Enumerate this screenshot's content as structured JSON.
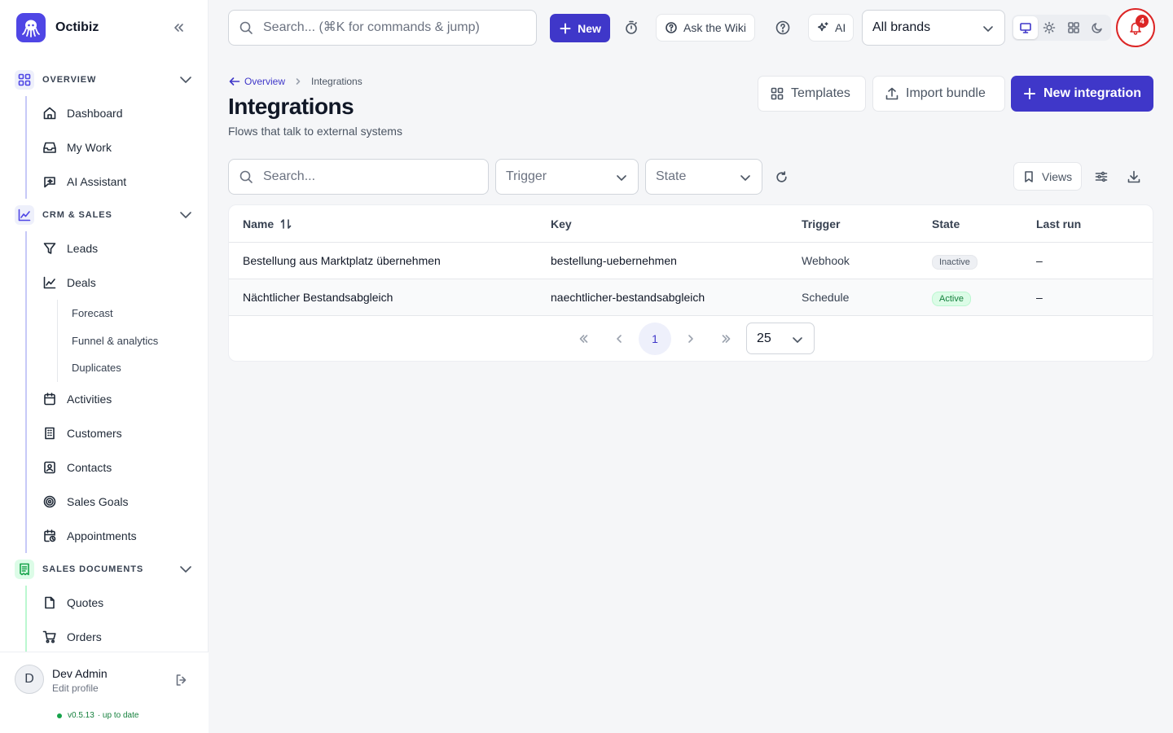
{
  "app": {
    "name": "Octibiz"
  },
  "sidebar": {
    "sections": [
      {
        "label": "OVERVIEW",
        "color": "#4f46e5",
        "items": [
          "Dashboard",
          "My Work",
          "AI Assistant"
        ]
      },
      {
        "label": "CRM & SALES",
        "color": "#4f46e5",
        "items": [
          "Leads",
          "Deals"
        ],
        "deals_sub": [
          "Forecast",
          "Funnel & analytics",
          "Duplicates"
        ],
        "items_after": [
          "Activities",
          "Customers",
          "Contacts",
          "Sales Goals",
          "Appointments"
        ]
      },
      {
        "label": "SALES DOCUMENTS",
        "color": "#16a34a",
        "items": [
          "Quotes",
          "Orders"
        ]
      }
    ],
    "user": {
      "initial": "D",
      "name": "Dev Admin",
      "sub": "Edit profile",
      "version": "v0.5.13",
      "version_status": "· up to date"
    }
  },
  "topbar": {
    "search_placeholder": "Search... (⌘K for commands & jump)",
    "new_label": "New",
    "wiki_label": "Ask the Wiki",
    "ai_label": "AI",
    "brand_select": "All brands",
    "notification_count": "4"
  },
  "page": {
    "breadcrumb_back": "Overview",
    "breadcrumb_current": "Integrations",
    "title": "Integrations",
    "subtitle": "Flows that talk to external systems",
    "templates_label": "Templates",
    "import_label": "Import bundle",
    "new_integration_label": "New integration"
  },
  "toolbar": {
    "search_placeholder": "Search...",
    "trigger_placeholder": "Trigger",
    "state_placeholder": "State",
    "views_label": "Views"
  },
  "table": {
    "columns": [
      "Name",
      "Key",
      "Trigger",
      "State",
      "Last run"
    ],
    "rows": [
      {
        "name": "Bestellung aus Marktplatz übernehmen",
        "key": "bestellung-uebernehmen",
        "trigger": "Webhook",
        "state": "Inactive",
        "last_run": "–"
      },
      {
        "name": "Nächtlicher Bestandsabgleich",
        "key": "naechtlicher-bestandsabgleich",
        "trigger": "Schedule",
        "state": "Active",
        "last_run": "–"
      }
    ],
    "current_page": "1",
    "page_size": "25"
  },
  "colors": {
    "primary": "#3f37c9",
    "active": "#15803d",
    "danger": "#dc2626"
  }
}
